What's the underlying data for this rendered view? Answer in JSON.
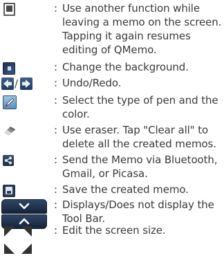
{
  "colon": ":",
  "undo_redo_separator": "/",
  "items": [
    {
      "icon": "other-function-icon",
      "text": "Use another function while leaving a memo on the screen. Tapping it again resumes editing of QMemo."
    },
    {
      "icon": "background-icon",
      "text": "Change the background."
    },
    {
      "icon": "undo-redo-icon",
      "text": "Undo/Redo."
    },
    {
      "icon": "pen-icon",
      "text": "Select the type of pen and the color."
    },
    {
      "icon": "eraser-icon",
      "text": "Use eraser. Tap \"Clear all\" to delete all the created memos."
    },
    {
      "icon": "share-icon",
      "text": "Send the Memo via Bluetooth, Gmail, or Picasa."
    },
    {
      "icon": "save-icon",
      "text": "Save the created memo."
    },
    {
      "icon": "toolbar-toggle-icon",
      "text": "Displays/Does not display the Tool Bar."
    },
    {
      "icon": "resize-icon",
      "text": "Edit the screen size."
    }
  ],
  "colors": {
    "text": "#3a3a3a",
    "icon_blue": "#2b3b55"
  }
}
